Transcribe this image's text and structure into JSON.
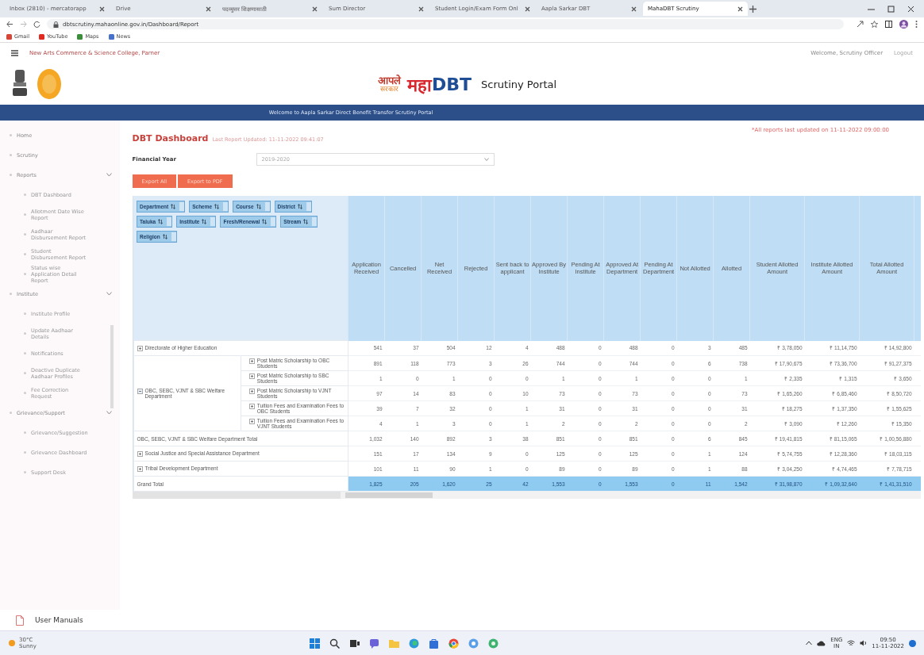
{
  "browser": {
    "tabs": [
      {
        "title": "Inbox (2810) - mercatorapp",
        "selected": false
      },
      {
        "title": "Drive",
        "selected": false
      },
      {
        "title": "पदव्युत्तर शिक्षणासाठी",
        "selected": false
      },
      {
        "title": "Sum Director",
        "selected": false
      },
      {
        "title": "Student Login/Exam Form Onl",
        "selected": false
      },
      {
        "title": "Aapla Sarkar DBT",
        "selected": false
      },
      {
        "title": "MahaDBT Scrutiny",
        "selected": true
      }
    ],
    "url": "dbtscrutiny.mahaonline.gov.in/Dashboard/Report",
    "bookmarks": [
      "Gmail",
      "YouTube",
      "Maps",
      "News"
    ]
  },
  "header": {
    "college": "New Arts Commerce & Science College, Parner",
    "user": "Welcome, Scrutiny Officer",
    "logout": "Logout"
  },
  "brand": {
    "aaple": "आपले",
    "sarkar": "सरकार",
    "maha": "महा",
    "dbt": "DBT",
    "portal": "Scrutiny Portal"
  },
  "banner": "Welcome to Aapla Sarkar Direct Benefit Transfer Scrutiny Portal",
  "update_note": "*All reports last updated on 11-11-2022 09:00:00",
  "sidebar": {
    "items": [
      {
        "label": "Home",
        "kind": "link"
      },
      {
        "label": "Scrutiny",
        "kind": "link"
      },
      {
        "label": "Reports",
        "kind": "group",
        "expanded": true,
        "children": [
          {
            "label": "DBT Dashboard"
          },
          {
            "label": "Allotment Date Wise Report"
          },
          {
            "label": "Aadhaar Disbursement Report"
          },
          {
            "label": "Student Disbursement Report"
          },
          {
            "label": "Status wise Application Detail Report"
          }
        ]
      },
      {
        "label": "Institute",
        "kind": "group",
        "expanded": true,
        "children": [
          {
            "label": "Institute Profile"
          },
          {
            "label": "Update Aadhaar Details"
          },
          {
            "label": "Notifications"
          },
          {
            "label": "Deactive Duplicate Aadhaar Profiles"
          },
          {
            "label": "Fee Correction Request"
          }
        ]
      },
      {
        "label": "Grievance/Support",
        "kind": "group",
        "expanded": true,
        "children": [
          {
            "label": "Grievance/Suggestion"
          },
          {
            "label": "Grievance Dashboard"
          },
          {
            "label": "Support Desk"
          }
        ]
      }
    ],
    "manuals": "User Manuals"
  },
  "dashboard": {
    "title": "DBT Dashboard",
    "subtitle": "Last Report Updated: 11-11-2022 09:41:07",
    "year_label": "Financial Year",
    "year": "2019-2020",
    "buttons": [
      "Export All",
      "Export to PDF"
    ],
    "filters": [
      "Department",
      "Scheme",
      "Course",
      "District",
      "Taluka",
      "Institute",
      "Fresh/Renewal",
      "Stream",
      "Religion"
    ],
    "columns": [
      "Application Received",
      "Cancelled",
      "Net Received",
      "Rejected",
      "Sent back to applicant",
      "Approved By Institute",
      "Pending At Institute",
      "Approved At Department",
      "Pending At Department",
      "Not Allotted",
      "Allotted",
      "Student Allotted Amount",
      "Institute Allotted Amount",
      "Total Allotted Amount"
    ],
    "rows": [
      {
        "kind": "department",
        "label": "Directorate of Higher Education",
        "expanded": false,
        "values": [
          "541",
          "37",
          "504",
          "12",
          "4",
          "488",
          "0",
          "488",
          "0",
          "3",
          "485",
          "₹ 3,78,050",
          "₹ 11,14,750",
          "₹ 14,92,800"
        ]
      },
      {
        "kind": "group",
        "label": "OBC, SEBC, VJNT & SBC Welfare Department",
        "expanded": true,
        "schemes": [
          {
            "label": "Post Matric Scholarship to OBC Students",
            "values": [
              "891",
              "118",
              "773",
              "3",
              "26",
              "744",
              "0",
              "744",
              "0",
              "6",
              "738",
              "₹ 17,90,675",
              "₹ 73,36,700",
              "₹ 91,27,375"
            ]
          },
          {
            "label": "Post Matric Scholarship to SBC Students",
            "values": [
              "1",
              "0",
              "1",
              "0",
              "0",
              "1",
              "0",
              "1",
              "0",
              "0",
              "1",
              "₹ 2,335",
              "₹ 1,315",
              "₹ 3,650"
            ]
          },
          {
            "label": "Post Matric Scholarship to VJNT Students",
            "values": [
              "97",
              "14",
              "83",
              "0",
              "10",
              "73",
              "0",
              "73",
              "0",
              "0",
              "73",
              "₹ 1,65,260",
              "₹ 6,85,460",
              "₹ 8,50,720"
            ]
          },
          {
            "label": "Tuition Fees and Examination Fees to OBC Students",
            "values": [
              "39",
              "7",
              "32",
              "0",
              "1",
              "31",
              "0",
              "31",
              "0",
              "0",
              "31",
              "₹ 18,275",
              "₹ 1,37,350",
              "₹ 1,55,625"
            ]
          },
          {
            "label": "Tuition Fees and Examination Fees to VJNT Students",
            "values": [
              "4",
              "1",
              "3",
              "0",
              "1",
              "2",
              "0",
              "2",
              "0",
              "0",
              "2",
              "₹ 3,090",
              "₹ 12,260",
              "₹ 15,350"
            ]
          }
        ]
      },
      {
        "kind": "subtotal",
        "label": "OBC, SEBC, VJNT & SBC Welfare Department Total",
        "values": [
          "1,032",
          "140",
          "892",
          "3",
          "38",
          "851",
          "0",
          "851",
          "0",
          "6",
          "845",
          "₹ 19,41,815",
          "₹ 81,15,065",
          "₹ 1,00,56,880"
        ]
      },
      {
        "kind": "department",
        "label": "Social Justice and Special Assistance Department",
        "expanded": false,
        "values": [
          "151",
          "17",
          "134",
          "9",
          "0",
          "125",
          "0",
          "125",
          "0",
          "1",
          "124",
          "₹ 5,74,755",
          "₹ 12,28,360",
          "₹ 18,03,115"
        ]
      },
      {
        "kind": "department",
        "label": "Tribal Development Department",
        "expanded": false,
        "values": [
          "101",
          "11",
          "90",
          "1",
          "0",
          "89",
          "0",
          "89",
          "0",
          "1",
          "88",
          "₹ 3,04,250",
          "₹ 4,74,465",
          "₹ 7,78,715"
        ]
      },
      {
        "kind": "total",
        "label": "Grand Total",
        "values": [
          "1,825",
          "205",
          "1,620",
          "25",
          "42",
          "1,553",
          "0",
          "1,553",
          "0",
          "11",
          "1,542",
          "₹ 31,98,870",
          "₹ 1,09,32,640",
          "₹ 1,41,31,510"
        ]
      }
    ]
  },
  "taskbar": {
    "weather": "30°C",
    "weather_note": "Sunny",
    "lang": "ENG",
    "lang_sub": "IN",
    "time": "09:50",
    "date": "11-11-2022"
  }
}
